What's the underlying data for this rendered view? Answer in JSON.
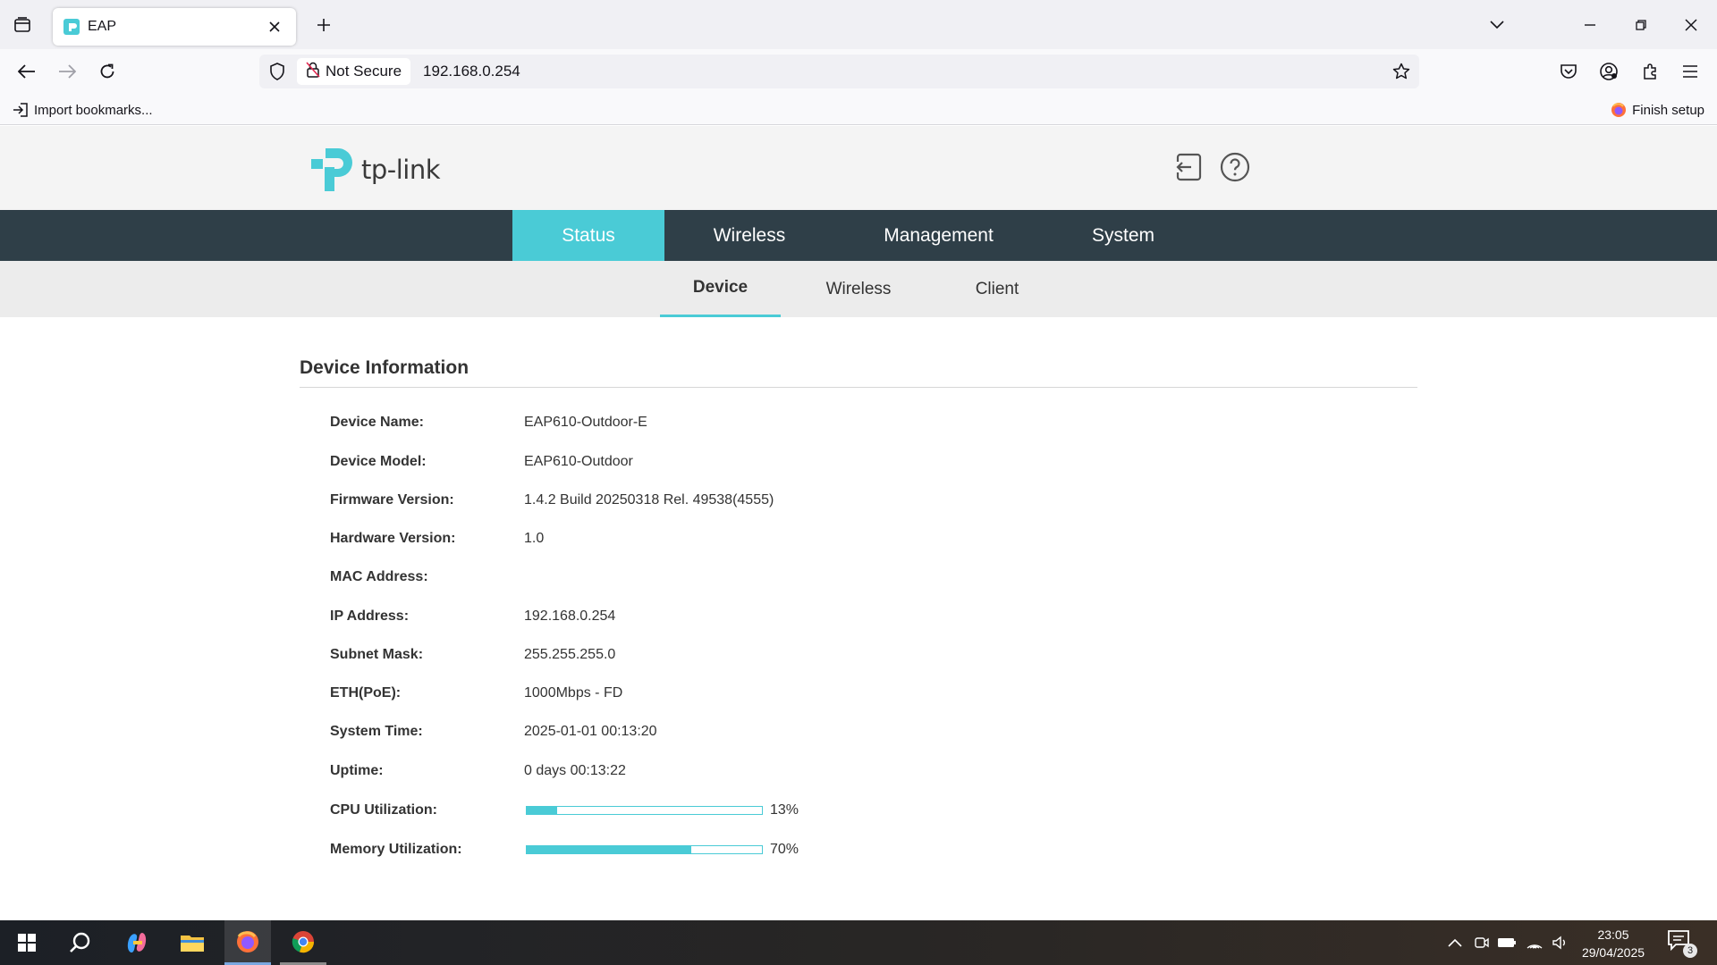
{
  "browser": {
    "tab_title": "EAP",
    "security_label": "Not Secure",
    "url": "192.168.0.254",
    "bookmark_import": "Import bookmarks...",
    "finish_setup": "Finish setup"
  },
  "header": {
    "logo_text": "tp-link"
  },
  "main_nav": [
    {
      "label": "Status",
      "active": true
    },
    {
      "label": "Wireless",
      "active": false
    },
    {
      "label": "Management",
      "active": false
    },
    {
      "label": "System",
      "active": false
    }
  ],
  "sub_nav": [
    {
      "label": "Device",
      "active": true
    },
    {
      "label": "Wireless",
      "active": false
    },
    {
      "label": "Client",
      "active": false
    }
  ],
  "device_info": {
    "title": "Device Information",
    "rows": [
      {
        "label": "Device Name:",
        "value": "EAP610-Outdoor-E"
      },
      {
        "label": "Device Model:",
        "value": "EAP610-Outdoor"
      },
      {
        "label": "Firmware Version:",
        "value": "1.4.2 Build 20250318 Rel. 49538(4555)"
      },
      {
        "label": "Hardware Version:",
        "value": "1.0"
      },
      {
        "label": "MAC Address:",
        "value": ""
      },
      {
        "label": "IP Address:",
        "value": "192.168.0.254"
      },
      {
        "label": "Subnet Mask:",
        "value": "255.255.255.0"
      },
      {
        "label": "ETH(PoE):",
        "value": "1000Mbps - FD"
      },
      {
        "label": "System Time:",
        "value": "2025-01-01 00:13:20"
      },
      {
        "label": "Uptime:",
        "value": "0 days 00:13:22"
      }
    ],
    "cpu": {
      "label": "CPU Utilization:",
      "percent": 13,
      "text": "13%"
    },
    "memory": {
      "label": "Memory Utilization:",
      "percent": 70,
      "text": "70%"
    }
  },
  "taskbar": {
    "time": "23:05",
    "date": "29/04/2025",
    "notification_count": "3"
  },
  "colors": {
    "accent": "#4acbd6",
    "nav_bg": "#2f3f48",
    "subnav_bg": "#ececec"
  }
}
